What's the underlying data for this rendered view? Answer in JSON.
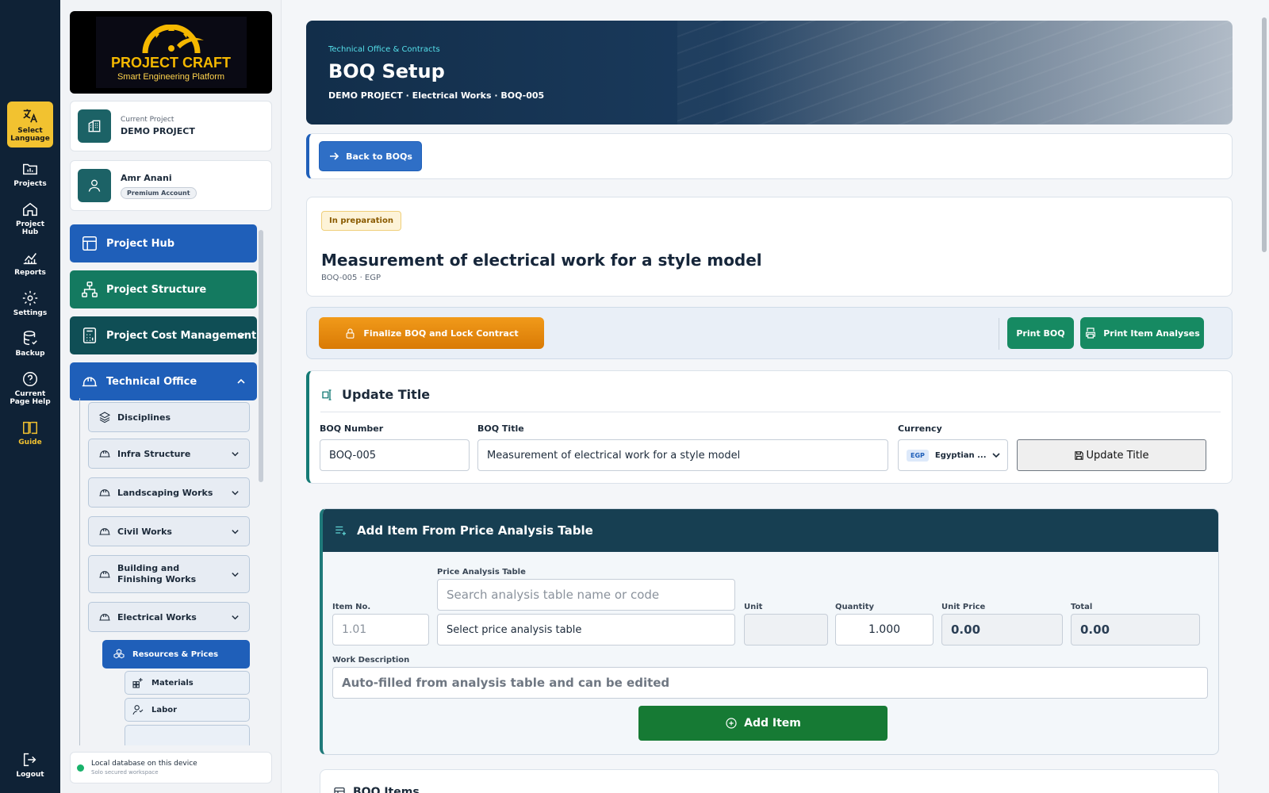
{
  "rail": {
    "language": "Select Language",
    "projects": "Projects",
    "project_hub": "Project Hub",
    "reports": "Reports",
    "settings": "Settings",
    "backup": "Backup",
    "help": "Current Page Help",
    "guide": "Guide",
    "logout": "Logout"
  },
  "brand": {
    "title": "PROJECT CRAFT",
    "subtitle": "Smart Engineering Platform"
  },
  "project_card": {
    "label": "Current Project",
    "name": "DEMO PROJECT"
  },
  "user_card": {
    "name": "Amr Anani",
    "badge": "Premium Account"
  },
  "nav": {
    "project_hub": "Project Hub",
    "project_structure": "Project Structure",
    "cost_management": "Project Cost Management",
    "technical_office": "Technical Office",
    "sub": {
      "disciplines": "Disciplines",
      "infra": "Infra Structure",
      "landscaping": "Landscaping Works",
      "civil": "Civil Works",
      "building": "Building and Finishing Works",
      "electrical": "Electrical Works",
      "resources": "Resources & Prices",
      "materials": "Materials",
      "labor": "Labor"
    }
  },
  "db_status": {
    "title": "Local database on this device",
    "subtitle": "Solo secured workspace"
  },
  "hero": {
    "crumb": "Technical Office & Contracts",
    "title": "BOQ Setup",
    "subtitle": "DEMO PROJECT · Electrical Works · BOQ-005"
  },
  "back_label": "Back to BOQs",
  "boq": {
    "status": "In preparation",
    "title": "Measurement of electrical work for a style model",
    "meta": "BOQ-005 · EGP"
  },
  "actions": {
    "finalize": "Finalize BOQ and Lock Contract",
    "print_boq": "Print BOQ",
    "print_analyses": "Print Item Analyses"
  },
  "update_section": {
    "title": "Update Title",
    "number_label": "BOQ Number",
    "number_value": "BOQ-005",
    "title_label": "BOQ Title",
    "title_value": "Measurement of electrical work for a style model",
    "currency_label": "Currency",
    "currency_code": "EGP",
    "currency_name": "Egyptian ...",
    "button": "Update Title"
  },
  "add_section": {
    "title": "Add Item From Price Analysis Table",
    "item_no_label": "Item No.",
    "item_no_placeholder": "1.01",
    "pat_label": "Price Analysis Table",
    "pat_search_placeholder": "Search analysis table name or code",
    "pat_select": "Select price analysis table",
    "unit_label": "Unit",
    "unit_value": "",
    "quantity_label": "Quantity",
    "quantity_value": "1.000",
    "unit_price_label": "Unit Price",
    "unit_price_value": "0.00",
    "total_label": "Total",
    "total_value": "0.00",
    "desc_label": "Work Description",
    "desc_placeholder": "Auto-filled from analysis table and can be edited",
    "add_button": "Add Item"
  },
  "items_section": {
    "title": "BOQ Items"
  },
  "colors": {
    "rail_bg": "#0f2236",
    "language_accent": "#f2c230",
    "primary_blue": "#1f5fb9",
    "teal": "#147a60",
    "dark_teal": "#0f4e55",
    "orange": "#e98a10",
    "green": "#168a62",
    "add_green": "#167a34"
  }
}
